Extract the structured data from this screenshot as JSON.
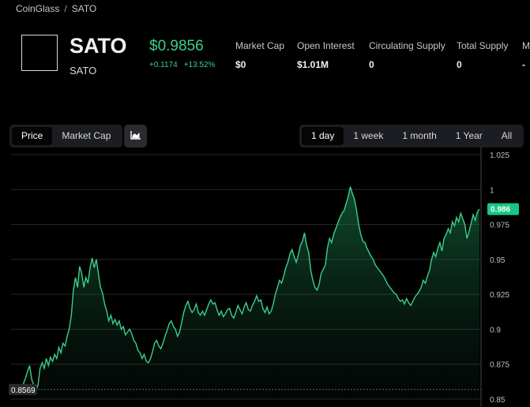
{
  "breadcrumb": {
    "home": "CoinGlass",
    "separator": "/",
    "current": "SATO"
  },
  "coin": {
    "symbol": "SATO",
    "name": "SATO"
  },
  "price": {
    "value": "$0.9856",
    "change_abs": "+0.1174",
    "change_pct": "+13.52%"
  },
  "stats": [
    {
      "label": "Market Cap",
      "value": "$0"
    },
    {
      "label": "Open Interest",
      "value": "$1.01M"
    },
    {
      "label": "Circulating Supply",
      "value": "0"
    },
    {
      "label": "Total Supply",
      "value": "0"
    },
    {
      "label": "Ma",
      "value": "-"
    }
  ],
  "view_tabs": [
    "Price",
    "Market Cap"
  ],
  "view_active": "Price",
  "chart_type_icon": "area-chart-icon",
  "range_tabs": [
    "1 day",
    "1 week",
    "1 month",
    "1 Year",
    "All"
  ],
  "range_active": "1 day",
  "colors": {
    "accent": "#3ad08a",
    "badge": "#16c784",
    "background": "#000000"
  },
  "chart_data": {
    "type": "area",
    "y_ticks": [
      "1.025",
      "1",
      "0.975",
      "0.95",
      "0.925",
      "0.9",
      "0.875",
      "0.85"
    ],
    "ylim": [
      0.85,
      1.025
    ],
    "grid": true,
    "current_label": "0.986",
    "min_label": "0.8569",
    "values": [
      0.856,
      0.861,
      0.865,
      0.87,
      0.874,
      0.864,
      0.86,
      0.856,
      0.86,
      0.872,
      0.876,
      0.872,
      0.879,
      0.874,
      0.88,
      0.877,
      0.882,
      0.879,
      0.887,
      0.883,
      0.89,
      0.888,
      0.895,
      0.9,
      0.91,
      0.928,
      0.937,
      0.93,
      0.945,
      0.94,
      0.93,
      0.937,
      0.933,
      0.944,
      0.951,
      0.944,
      0.95,
      0.94,
      0.93,
      0.926,
      0.918,
      0.913,
      0.906,
      0.91,
      0.904,
      0.907,
      0.903,
      0.906,
      0.9,
      0.902,
      0.896,
      0.898,
      0.9,
      0.897,
      0.892,
      0.89,
      0.885,
      0.883,
      0.879,
      0.882,
      0.877,
      0.876,
      0.879,
      0.884,
      0.89,
      0.892,
      0.888,
      0.886,
      0.89,
      0.895,
      0.899,
      0.904,
      0.906,
      0.902,
      0.9,
      0.895,
      0.898,
      0.905,
      0.912,
      0.917,
      0.92,
      0.915,
      0.912,
      0.914,
      0.918,
      0.912,
      0.91,
      0.913,
      0.91,
      0.914,
      0.918,
      0.921,
      0.918,
      0.919,
      0.914,
      0.91,
      0.913,
      0.909,
      0.911,
      0.914,
      0.915,
      0.91,
      0.908,
      0.912,
      0.917,
      0.914,
      0.911,
      0.916,
      0.919,
      0.914,
      0.913,
      0.917,
      0.92,
      0.924,
      0.92,
      0.921,
      0.915,
      0.912,
      0.916,
      0.911,
      0.913,
      0.918,
      0.925,
      0.93,
      0.935,
      0.933,
      0.938,
      0.944,
      0.948,
      0.954,
      0.957,
      0.952,
      0.948,
      0.953,
      0.96,
      0.963,
      0.969,
      0.96,
      0.955,
      0.942,
      0.935,
      0.93,
      0.928,
      0.932,
      0.94,
      0.943,
      0.946,
      0.958,
      0.965,
      0.962,
      0.968,
      0.972,
      0.976,
      0.98,
      0.983,
      0.985,
      0.99,
      0.995,
      1.002,
      0.997,
      0.993,
      0.985,
      0.975,
      0.968,
      0.963,
      0.962,
      0.958,
      0.955,
      0.952,
      0.95,
      0.946,
      0.944,
      0.942,
      0.94,
      0.938,
      0.935,
      0.932,
      0.93,
      0.928,
      0.926,
      0.925,
      0.922,
      0.92,
      0.921,
      0.918,
      0.922,
      0.919,
      0.917,
      0.92,
      0.923,
      0.925,
      0.927,
      0.93,
      0.935,
      0.933,
      0.938,
      0.942,
      0.95,
      0.955,
      0.952,
      0.958,
      0.962,
      0.956,
      0.965,
      0.968,
      0.972,
      0.969,
      0.977,
      0.974,
      0.98,
      0.977,
      0.983,
      0.979,
      0.975,
      0.965,
      0.97,
      0.976,
      0.982,
      0.978,
      0.984,
      0.986
    ]
  }
}
